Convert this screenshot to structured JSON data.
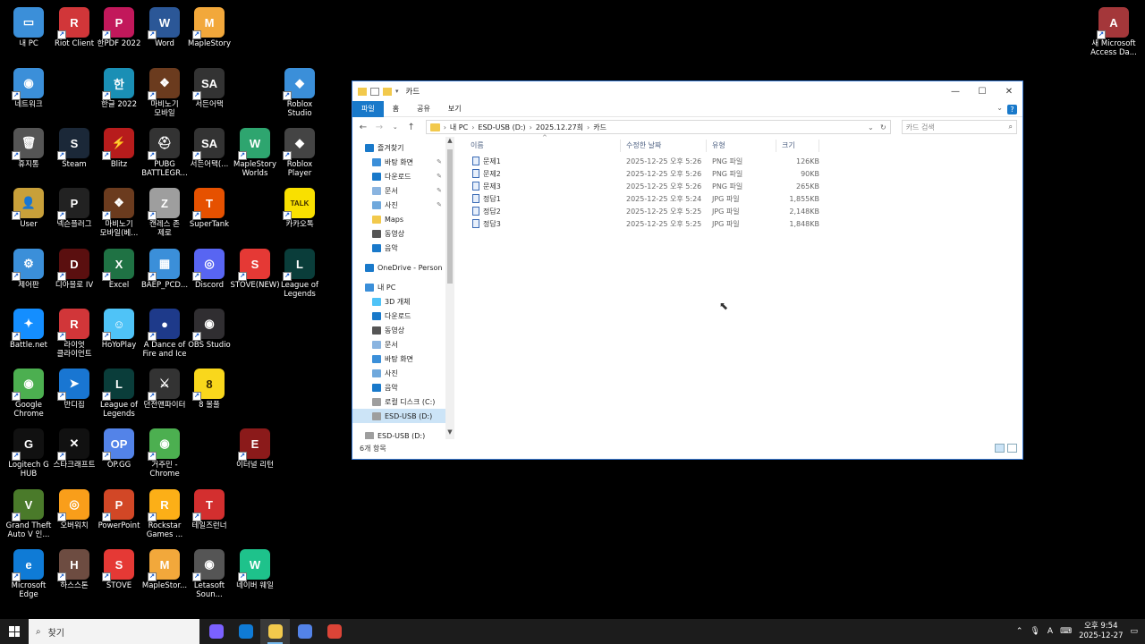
{
  "desktop": {
    "icons": [
      {
        "label": "내 PC",
        "glyph": "▭",
        "color": "#3b8fd9"
      },
      {
        "label": "Riot Client",
        "glyph": "R",
        "color": "#d13639"
      },
      {
        "label": "한PDF 2022",
        "glyph": "P",
        "color": "#c2185b"
      },
      {
        "label": "Word",
        "glyph": "W",
        "color": "#2b5797"
      },
      {
        "label": "MapleStory",
        "glyph": "M",
        "color": "#f2a83b"
      },
      {
        "label": "네트워크",
        "glyph": "◉",
        "color": "#3b8fd9"
      },
      {
        "label": "한글 2022",
        "glyph": "한",
        "color": "#1a8fb5"
      },
      {
        "label": "마비노기\n모바일",
        "glyph": "❖",
        "color": "#6b3b1e"
      },
      {
        "label": "서든어택",
        "glyph": "SA",
        "color": "#333333"
      },
      {
        "label": "Roblox\nStudio",
        "glyph": "◆",
        "color": "#3b8fd9"
      },
      {
        "label": "휴지통",
        "glyph": "🗑",
        "color": "#555555"
      },
      {
        "label": "Steam",
        "glyph": "S",
        "color": "#1b2838"
      },
      {
        "label": "Blitz",
        "glyph": "⚡",
        "color": "#b71c1c"
      },
      {
        "label": "PUBG\nBATTLEGR...",
        "glyph": "⛑",
        "color": "#333333"
      },
      {
        "label": "서든어택(...",
        "glyph": "SA",
        "color": "#333333"
      },
      {
        "label": "MapleStory\nWorlds",
        "glyph": "W",
        "color": "#2ea56f"
      },
      {
        "label": "Roblox\nPlayer",
        "glyph": "◆",
        "color": "#444444"
      },
      {
        "label": "User",
        "glyph": "👤",
        "color": "#c8a03a"
      },
      {
        "label": "넥슨플러그",
        "glyph": "P",
        "color": "#222222"
      },
      {
        "label": "마비노기\n모바일(베...",
        "glyph": "❖",
        "color": "#6b3b1e"
      },
      {
        "label": "캔레스 존\n제로",
        "glyph": "Z",
        "color": "#9e9e9e"
      },
      {
        "label": "SuperTank",
        "glyph": "T",
        "color": "#e65100"
      },
      {
        "label": "카카오톡",
        "glyph": "TALK",
        "color": "#f9e000"
      },
      {
        "label": "제어판",
        "glyph": "⚙",
        "color": "#3b8fd9"
      },
      {
        "label": "디아블로 IV",
        "glyph": "D",
        "color": "#5a0f0f"
      },
      {
        "label": "Excel",
        "glyph": "X",
        "color": "#1f7244"
      },
      {
        "label": "BAEP_PCD...",
        "glyph": "▦",
        "color": "#3b8fd9"
      },
      {
        "label": "Discord",
        "glyph": "◎",
        "color": "#5865f2"
      },
      {
        "label": "STOVE(NEW)",
        "glyph": "S",
        "color": "#e53935"
      },
      {
        "label": "League of\nLegends",
        "glyph": "L",
        "color": "#0a3d3a"
      },
      {
        "label": "Battle.net",
        "glyph": "✦",
        "color": "#148eff"
      },
      {
        "label": "라이엇\n클라이언트",
        "glyph": "R",
        "color": "#d13639"
      },
      {
        "label": "HoYoPlay",
        "glyph": "☺",
        "color": "#4fc3f7"
      },
      {
        "label": "A Dance of\nFire and Ice",
        "glyph": "●",
        "color": "#1e3a8a"
      },
      {
        "label": "OBS Studio",
        "glyph": "◉",
        "color": "#302e31"
      },
      {
        "label": "Google\nChrome",
        "glyph": "◉",
        "color": "#4caf50"
      },
      {
        "label": "반디집",
        "glyph": "➤",
        "color": "#1976d2"
      },
      {
        "label": "League of\nLegends",
        "glyph": "L",
        "color": "#0a3d3a"
      },
      {
        "label": "던전앤파이터",
        "glyph": "⚔",
        "color": "#333333"
      },
      {
        "label": "8 볼풀",
        "glyph": "8",
        "color": "#f9d71c"
      },
      {
        "label": "Logitech G\nHUB",
        "glyph": "G",
        "color": "#111111"
      },
      {
        "label": "스타크래프트",
        "glyph": "✕",
        "color": "#111111"
      },
      {
        "label": "OP.GG",
        "glyph": "OP",
        "color": "#5383e8"
      },
      {
        "label": "거주민 -\nChrome",
        "glyph": "◉",
        "color": "#4caf50"
      },
      {
        "label": "이터널 리턴",
        "glyph": "E",
        "color": "#8b1a1a"
      },
      {
        "label": "Grand Theft\nAuto V 인...",
        "glyph": "V",
        "color": "#4a7a2a"
      },
      {
        "label": "오버워치",
        "glyph": "◎",
        "color": "#f99e1a"
      },
      {
        "label": "PowerPoint",
        "glyph": "P",
        "color": "#d24726"
      },
      {
        "label": "Rockstar\nGames ...",
        "glyph": "R",
        "color": "#fcaf17"
      },
      {
        "label": "테일즈런너",
        "glyph": "T",
        "color": "#d32f2f"
      },
      {
        "label": "Microsoft\nEdge",
        "glyph": "e",
        "color": "#0f7bd6"
      },
      {
        "label": "하스스톤",
        "glyph": "H",
        "color": "#6d4c41"
      },
      {
        "label": "STOVE",
        "glyph": "S",
        "color": "#e53935"
      },
      {
        "label": "MapleStor...",
        "glyph": "M",
        "color": "#f2a83b"
      },
      {
        "label": "Letasoft\nSoun...",
        "glyph": "◉",
        "color": "#555555"
      },
      {
        "label": "네이버 웨일",
        "glyph": "W",
        "color": "#1ec28b"
      },
      {
        "label": "새 Microsoft\nAccess Da...",
        "glyph": "A",
        "color": "#a4373a"
      }
    ]
  },
  "explorer": {
    "title": "카드",
    "ribbon_tabs": [
      "파일",
      "홈",
      "공유",
      "보기"
    ],
    "address": [
      "내 PC",
      "ESD-USB (D:)",
      "2025.12.27희",
      "카드"
    ],
    "search_placeholder": "카드 검색",
    "nav_items": [
      {
        "label": "즐겨찾기",
        "color": "#1979ca",
        "pin": false,
        "indent": 0
      },
      {
        "label": "바탕 화면",
        "color": "#3b8fd9",
        "pin": true,
        "indent": 1
      },
      {
        "label": "다운로드",
        "color": "#1979ca",
        "pin": true,
        "indent": 1
      },
      {
        "label": "문서",
        "color": "#8ab4e0",
        "pin": true,
        "indent": 1
      },
      {
        "label": "사진",
        "color": "#6fa8dc",
        "pin": true,
        "indent": 1
      },
      {
        "label": "Maps",
        "color": "#f2c94c",
        "pin": false,
        "indent": 1
      },
      {
        "label": "동영상",
        "color": "#555555",
        "pin": false,
        "indent": 1
      },
      {
        "label": "음악",
        "color": "#1979ca",
        "pin": false,
        "indent": 1
      },
      {
        "label": "",
        "color": "",
        "pin": false,
        "indent": 0
      },
      {
        "label": "OneDrive - Person",
        "color": "#1979ca",
        "pin": false,
        "indent": 0
      },
      {
        "label": "",
        "color": "",
        "pin": false,
        "indent": 0
      },
      {
        "label": "내 PC",
        "color": "#3b8fd9",
        "pin": false,
        "indent": 0
      },
      {
        "label": "3D 개체",
        "color": "#4fc3f7",
        "pin": false,
        "indent": 1
      },
      {
        "label": "다운로드",
        "color": "#1979ca",
        "pin": false,
        "indent": 1
      },
      {
        "label": "동영상",
        "color": "#555555",
        "pin": false,
        "indent": 1
      },
      {
        "label": "문서",
        "color": "#8ab4e0",
        "pin": false,
        "indent": 1
      },
      {
        "label": "바탕 화면",
        "color": "#3b8fd9",
        "pin": false,
        "indent": 1
      },
      {
        "label": "사진",
        "color": "#6fa8dc",
        "pin": false,
        "indent": 1
      },
      {
        "label": "음악",
        "color": "#1979ca",
        "pin": false,
        "indent": 1
      },
      {
        "label": "로컬 디스크 (C:)",
        "color": "#9e9e9e",
        "pin": false,
        "indent": 1
      },
      {
        "label": "ESD-USB (D:)",
        "color": "#9e9e9e",
        "pin": false,
        "indent": 1,
        "selected": true
      },
      {
        "label": "",
        "color": "",
        "pin": false,
        "indent": 0
      },
      {
        "label": "ESD-USB (D:)",
        "color": "#9e9e9e",
        "pin": false,
        "indent": 0
      }
    ],
    "columns": [
      "이름",
      "수정한 날짜",
      "유형",
      "크기"
    ],
    "files": [
      {
        "name": "문제1",
        "date": "2025-12-25 오후 5:26",
        "type": "PNG 파일",
        "size": "126KB"
      },
      {
        "name": "문제2",
        "date": "2025-12-25 오후 5:26",
        "type": "PNG 파일",
        "size": "90KB"
      },
      {
        "name": "문제3",
        "date": "2025-12-25 오후 5:26",
        "type": "PNG 파일",
        "size": "265KB"
      },
      {
        "name": "정답1",
        "date": "2025-12-25 오후 5:24",
        "type": "JPG 파일",
        "size": "1,855KB"
      },
      {
        "name": "정답2",
        "date": "2025-12-25 오후 5:25",
        "type": "JPG 파일",
        "size": "2,148KB"
      },
      {
        "name": "정답3",
        "date": "2025-12-25 오후 5:25",
        "type": "JPG 파일",
        "size": "1,848KB"
      }
    ],
    "status": "6개 항목"
  },
  "taskbar": {
    "search_placeholder": "찾기",
    "apps": [
      {
        "name": "copilot-icon",
        "color": "#7b61ff"
      },
      {
        "name": "edge-icon",
        "color": "#0f7bd6"
      },
      {
        "name": "file-explorer-icon",
        "color": "#f2c94c",
        "active": true
      },
      {
        "name": "opgg-icon",
        "color": "#5383e8"
      },
      {
        "name": "chrome-icon",
        "color": "#db4437"
      }
    ],
    "time": "오후 9:54",
    "date": "2025-12-27",
    "ime": "A"
  }
}
